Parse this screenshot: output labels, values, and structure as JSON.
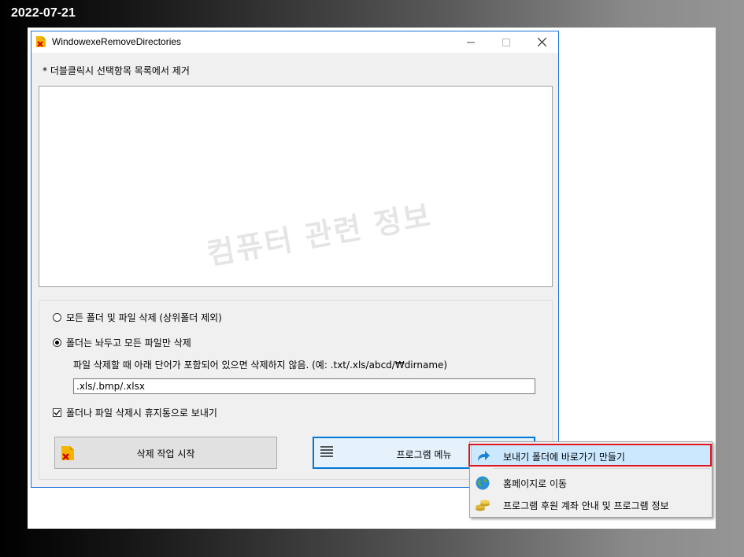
{
  "date_label": "2022-07-21",
  "window": {
    "title": "WindowexeRemoveDirectories",
    "hint": "* 더블클릭시 선택항목 목록에서 제거",
    "watermark": "컴퓨터 관련 정보"
  },
  "options": {
    "radio_all_label": "모든 폴더 및 파일 삭제 (상위폴더 제외)",
    "radio_all_selected": false,
    "radio_files_label": "폴더는 놔두고 모든 파일만 삭제",
    "radio_files_selected": true,
    "exclude_desc": "파일 삭제할 때 아래 단어가 포함되어 있으면 삭제하지 않음. (예: .txt/.xls/abcd/₩dirname)",
    "exclude_value": ".xls/.bmp/.xlsx",
    "recycle_label": "폴더나 파일 삭제시 휴지통으로 보내기",
    "recycle_checked": true
  },
  "buttons": {
    "start_label": "삭제 작업 시작",
    "menu_label": "프로그램 메뉴"
  },
  "context_menu": {
    "items": [
      {
        "label": "보내기 폴더에 바로가기 만들기",
        "icon": "send-to-shortcut-icon",
        "selected": true
      },
      {
        "label": "홈페이지로 이동",
        "icon": "globe-icon",
        "selected": false
      },
      {
        "label": "프로그램 후원 계좌 안내 및 프로그램 정보",
        "icon": "coins-icon",
        "selected": false
      }
    ]
  },
  "colors": {
    "accent": "#0078d7",
    "highlight_border": "#e0141e",
    "selection_bg": "#cce8ff"
  }
}
